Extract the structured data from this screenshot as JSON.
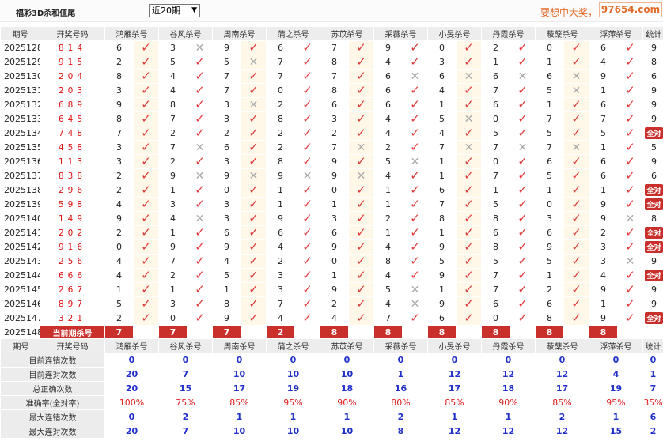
{
  "header": {
    "title": "福彩3D杀和值尾",
    "period_select": "近20期",
    "marquee": "要想中大奖，",
    "site": "97654.com"
  },
  "columns": [
    "期号",
    "开奖号码",
    "鸿雁杀号",
    "谷风杀号",
    "周南杀号",
    "蒲之杀号",
    "苏苡杀号",
    "采薇杀号",
    "小旻杀号",
    "丹霞杀号",
    "蔽蘖杀号",
    "浮萍杀号",
    "统计"
  ],
  "rows": [
    {
      "period": "2025128",
      "draw": "814",
      "nums": [
        6,
        3,
        9,
        6,
        7,
        9,
        0,
        2,
        0,
        6
      ],
      "marks": [
        1,
        0,
        1,
        1,
        1,
        1,
        1,
        1,
        1,
        1
      ],
      "stat": "9"
    },
    {
      "period": "2025129",
      "draw": "915",
      "nums": [
        2,
        5,
        5,
        7,
        8,
        4,
        3,
        1,
        1,
        4
      ],
      "marks": [
        1,
        1,
        0,
        1,
        1,
        1,
        1,
        1,
        1,
        1
      ],
      "stat": "8"
    },
    {
      "period": "2025130",
      "draw": "204",
      "nums": [
        8,
        4,
        7,
        7,
        7,
        6,
        6,
        6,
        6,
        9
      ],
      "marks": [
        1,
        1,
        1,
        1,
        1,
        0,
        0,
        0,
        0,
        1
      ],
      "stat": "6"
    },
    {
      "period": "2025131",
      "draw": "203",
      "nums": [
        3,
        4,
        7,
        0,
        8,
        6,
        4,
        7,
        5,
        1
      ],
      "marks": [
        1,
        1,
        1,
        1,
        1,
        1,
        1,
        1,
        0,
        1
      ],
      "stat": "9"
    },
    {
      "period": "2025132",
      "draw": "689",
      "nums": [
        9,
        8,
        3,
        2,
        6,
        6,
        1,
        6,
        1,
        6
      ],
      "marks": [
        1,
        1,
        0,
        1,
        1,
        1,
        1,
        1,
        1,
        1
      ],
      "stat": "9"
    },
    {
      "period": "2025133",
      "draw": "645",
      "nums": [
        8,
        7,
        3,
        8,
        3,
        4,
        5,
        0,
        7,
        7
      ],
      "marks": [
        1,
        1,
        1,
        1,
        1,
        1,
        0,
        1,
        1,
        1
      ],
      "stat": "9"
    },
    {
      "period": "2025134",
      "draw": "748",
      "nums": [
        7,
        2,
        2,
        2,
        2,
        4,
        4,
        5,
        5,
        5
      ],
      "marks": [
        1,
        1,
        1,
        1,
        1,
        1,
        1,
        1,
        1,
        1
      ],
      "stat": "全对"
    },
    {
      "period": "2025135",
      "draw": "458",
      "nums": [
        3,
        7,
        6,
        2,
        7,
        2,
        7,
        7,
        7,
        1
      ],
      "marks": [
        1,
        0,
        1,
        1,
        0,
        1,
        0,
        0,
        0,
        1
      ],
      "stat": "5"
    },
    {
      "period": "2025136",
      "draw": "113",
      "nums": [
        3,
        2,
        3,
        8,
        9,
        5,
        1,
        0,
        6,
        6
      ],
      "marks": [
        1,
        1,
        1,
        1,
        1,
        0,
        1,
        1,
        1,
        1
      ],
      "stat": "9"
    },
    {
      "period": "2025137",
      "draw": "838",
      "nums": [
        2,
        9,
        9,
        9,
        9,
        4,
        1,
        7,
        5,
        6
      ],
      "marks": [
        1,
        0,
        0,
        0,
        0,
        1,
        1,
        1,
        1,
        1
      ],
      "stat": "6"
    },
    {
      "period": "2025138",
      "draw": "296",
      "nums": [
        2,
        1,
        0,
        1,
        0,
        1,
        6,
        1,
        1,
        1
      ],
      "marks": [
        1,
        1,
        1,
        1,
        1,
        1,
        1,
        1,
        1,
        1
      ],
      "stat": "全对"
    },
    {
      "period": "2025139",
      "draw": "598",
      "nums": [
        4,
        3,
        3,
        1,
        1,
        1,
        7,
        5,
        0,
        9
      ],
      "marks": [
        1,
        1,
        1,
        1,
        1,
        1,
        1,
        1,
        1,
        1
      ],
      "stat": "全对"
    },
    {
      "period": "2025140",
      "draw": "149",
      "nums": [
        9,
        4,
        3,
        9,
        3,
        2,
        8,
        8,
        3,
        9
      ],
      "marks": [
        1,
        0,
        1,
        1,
        1,
        1,
        1,
        1,
        1,
        0
      ],
      "stat": "8"
    },
    {
      "period": "2025141",
      "draw": "202",
      "nums": [
        2,
        1,
        6,
        6,
        6,
        1,
        1,
        6,
        6,
        2
      ],
      "marks": [
        1,
        1,
        1,
        1,
        1,
        1,
        1,
        1,
        1,
        1
      ],
      "stat": "全对"
    },
    {
      "period": "2025142",
      "draw": "916",
      "nums": [
        0,
        9,
        9,
        4,
        9,
        4,
        9,
        8,
        9,
        3
      ],
      "marks": [
        1,
        1,
        1,
        1,
        1,
        1,
        1,
        1,
        1,
        1
      ],
      "stat": "全对"
    },
    {
      "period": "2025143",
      "draw": "256",
      "nums": [
        4,
        7,
        4,
        2,
        0,
        8,
        5,
        5,
        5,
        3
      ],
      "marks": [
        1,
        1,
        1,
        1,
        1,
        1,
        1,
        1,
        1,
        0
      ],
      "stat": "9"
    },
    {
      "period": "2025144",
      "draw": "666",
      "nums": [
        4,
        2,
        5,
        3,
        1,
        4,
        9,
        7,
        1,
        4
      ],
      "marks": [
        1,
        1,
        1,
        1,
        1,
        1,
        1,
        1,
        1,
        1
      ],
      "stat": "全对"
    },
    {
      "period": "2025145",
      "draw": "267",
      "nums": [
        1,
        1,
        1,
        3,
        9,
        5,
        1,
        7,
        2,
        9
      ],
      "marks": [
        1,
        1,
        1,
        1,
        1,
        0,
        1,
        1,
        1,
        1
      ],
      "stat": "9"
    },
    {
      "period": "2025146",
      "draw": "897",
      "nums": [
        5,
        3,
        8,
        7,
        2,
        4,
        9,
        6,
        6,
        1
      ],
      "marks": [
        1,
        1,
        1,
        1,
        1,
        0,
        1,
        1,
        1,
        1
      ],
      "stat": "9"
    },
    {
      "period": "2025147",
      "draw": "321",
      "nums": [
        2,
        0,
        9,
        4,
        4,
        7,
        6,
        0,
        8,
        9
      ],
      "marks": [
        1,
        1,
        1,
        1,
        1,
        1,
        1,
        1,
        1,
        1
      ],
      "stat": "全对"
    }
  ],
  "current": {
    "period": "2025148",
    "label": "当前期杀号",
    "values": [
      7,
      7,
      7,
      2,
      8,
      8,
      8,
      8,
      8,
      8
    ]
  },
  "stats": [
    {
      "label": "目前连错次数",
      "values": [
        "0",
        "0",
        "0",
        "0",
        "0",
        "0",
        "0",
        "0",
        "0",
        "0",
        "0"
      ],
      "red": false
    },
    {
      "label": "目前连对次数",
      "values": [
        "20",
        "7",
        "10",
        "10",
        "10",
        "1",
        "12",
        "12",
        "12",
        "4",
        "1"
      ],
      "red": false
    },
    {
      "label": "总正确次数",
      "values": [
        "20",
        "15",
        "17",
        "19",
        "18",
        "16",
        "17",
        "18",
        "17",
        "19",
        "7"
      ],
      "red": false
    },
    {
      "label": "准确率(全对率)",
      "values": [
        "100%",
        "75%",
        "85%",
        "95%",
        "90%",
        "80%",
        "85%",
        "90%",
        "85%",
        "95%",
        "35%"
      ],
      "red": true
    },
    {
      "label": "最大连错次数",
      "values": [
        "0",
        "2",
        "1",
        "1",
        "1",
        "2",
        "1",
        "1",
        "2",
        "1",
        "6"
      ],
      "red": false
    },
    {
      "label": "最大连对次数",
      "values": [
        "20",
        "7",
        "10",
        "10",
        "10",
        "8",
        "12",
        "12",
        "12",
        "15",
        "2"
      ],
      "red": false
    }
  ],
  "glyphs": {
    "check": "✓",
    "cross": "✕"
  },
  "colors": {
    "accent": "#c9302c",
    "check": "#e23a3a",
    "value": "#2030c8",
    "highlight": "#fff7e8"
  }
}
